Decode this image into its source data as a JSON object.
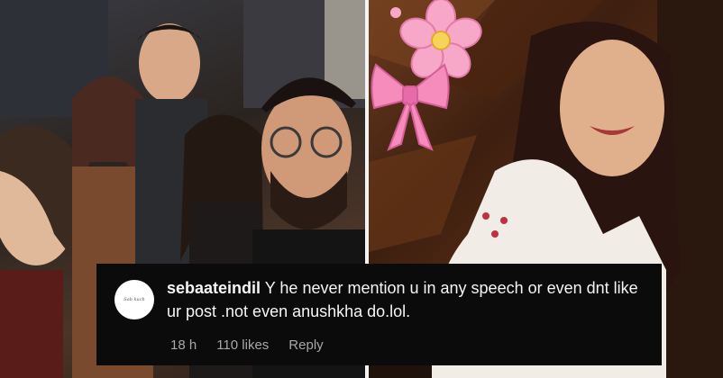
{
  "left_photo": {
    "description_icon": "group-selfie-photo"
  },
  "right_photo": {
    "description_icon": "woman-portrait-photo",
    "stickers": [
      "flower-sticker-icon",
      "bow-sticker-icon"
    ]
  },
  "comment": {
    "avatar_text": "Sab kuch",
    "username": "sebaateindil",
    "text": "Y he never mention u in any speech or even dnt like ur post .not even anushkha do.lol.",
    "time": "18 h",
    "likes": "110 likes",
    "reply_label": "Reply"
  },
  "colors": {
    "comment_bg": "#0b0b0b",
    "text": "#f5f5f5",
    "meta": "#a8a8a8",
    "divider": "#f4f4f4"
  }
}
